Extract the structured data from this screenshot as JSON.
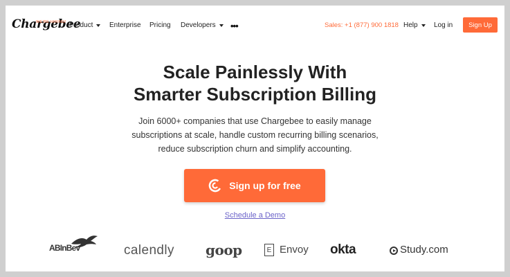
{
  "header": {
    "logo_text": "Chargebee",
    "hiring_text": "WE'RE HIRING!",
    "nav": [
      {
        "label": "Product",
        "dropdown": true
      },
      {
        "label": "Enterprise",
        "dropdown": false
      },
      {
        "label": "Pricing",
        "dropdown": false
      },
      {
        "label": "Developers",
        "dropdown": true
      }
    ],
    "more_label": "•••",
    "sales": "Sales: +1 (877) 900 1818",
    "help": "Help",
    "login": "Log in",
    "signup": "Sign Up"
  },
  "hero": {
    "title_line1": "Scale Painlessly With",
    "title_line2": "Smarter Subscription Billing",
    "desc_line1": "Join 6000+ companies that use Chargebee to easily manage",
    "desc_line2": "subscriptions at scale, handle custom recurring billing scenarios,",
    "desc_line3": "reduce subscription churn and simplify accounting.",
    "cta": "Sign up for free",
    "demo": "Schedule a Demo"
  },
  "logos": {
    "abinbev": "ABInBev",
    "calendly": "calendly",
    "goop": "goop",
    "envoy_mark": "E",
    "envoy": "Envoy",
    "okta": "okta",
    "study": "Study.com"
  },
  "colors": {
    "accent": "#ff6a38",
    "link": "#6b63c9",
    "text": "#222222"
  }
}
